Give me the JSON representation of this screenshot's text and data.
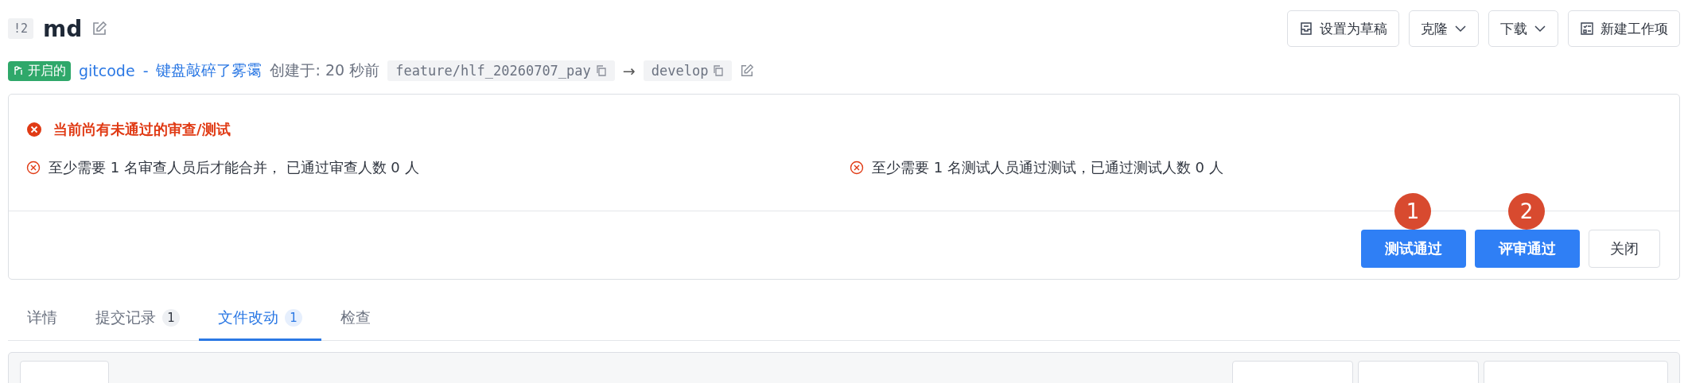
{
  "header": {
    "id_badge": "!2",
    "title": "md",
    "actions": [
      {
        "label": "设置为草稿",
        "kind": "draft"
      },
      {
        "label": "克隆",
        "kind": "dropdown"
      },
      {
        "label": "下载",
        "kind": "dropdown"
      },
      {
        "label": "新建工作项",
        "kind": "task"
      }
    ]
  },
  "meta": {
    "status": "开启的",
    "owner": "gitcode",
    "separator": "-",
    "author": "键盘敲碎了雾霭",
    "created": "创建于: 20 秒前",
    "source_branch": "feature/hlf_20260707_pay",
    "arrow": "→",
    "target_branch": "develop"
  },
  "alert": {
    "title": "当前尚有未通过的审查/测试",
    "requirements": [
      "至少需要 1 名审查人员后才能合并， 已通过审查人数 0 人",
      "至少需要 1 名测试人员通过测试，已通过测试人数 0 人"
    ],
    "buttons": [
      {
        "label": "测试通过",
        "kind": "primary",
        "marker": "1"
      },
      {
        "label": "评审通过",
        "kind": "primary",
        "marker": "2"
      },
      {
        "label": "关闭",
        "kind": "plain"
      }
    ]
  },
  "tabs": [
    {
      "label": "详情",
      "selected": false
    },
    {
      "label": "提交记录",
      "count": "1",
      "selected": false
    },
    {
      "label": "文件改动",
      "count": "1",
      "selected": true
    },
    {
      "label": "检查",
      "selected": false
    }
  ]
}
